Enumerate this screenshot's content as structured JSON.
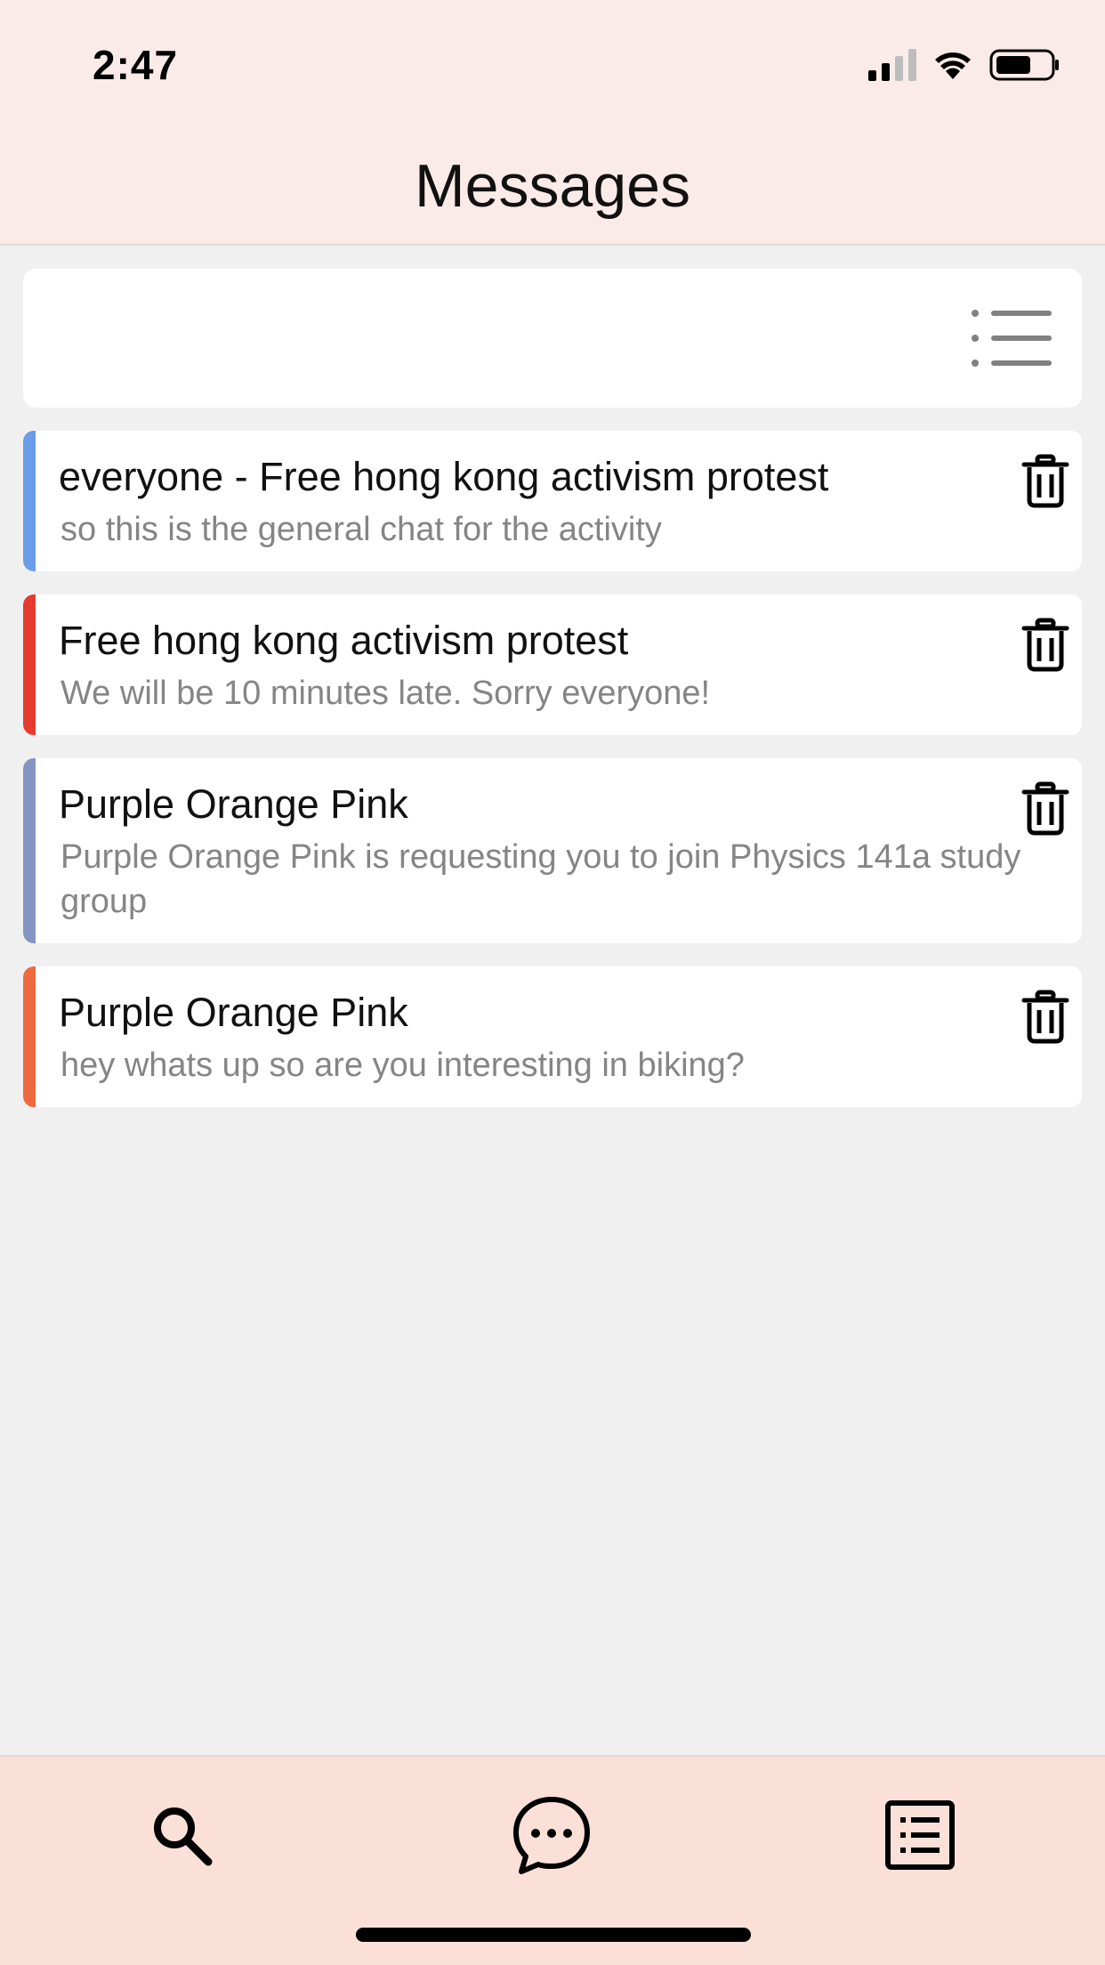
{
  "status_bar": {
    "time": "2:47"
  },
  "header": {
    "title": "Messages"
  },
  "filter": {
    "icon": "list-filter-icon"
  },
  "messages": [
    {
      "title": "everyone - Free hong kong activism protest",
      "preview": "so this is the general chat for the activity",
      "accent": "#6b9de8"
    },
    {
      "title": "Free hong kong activism protest",
      "preview": "We will be 10 minutes late. Sorry everyone!",
      "accent": "#e43b2e"
    },
    {
      "title": "Purple Orange Pink",
      "preview": "Purple Orange Pink is requesting you to join Physics  141a study group",
      "accent": "#8495c4"
    },
    {
      "title": "Purple Orange Pink",
      "preview": "hey whats up so are you interesting in biking?",
      "accent": "#ee6a3e"
    }
  ],
  "tabbar": {
    "tabs": [
      {
        "icon": "search-icon"
      },
      {
        "icon": "chat-bubble-icon"
      },
      {
        "icon": "list-icon"
      }
    ]
  }
}
